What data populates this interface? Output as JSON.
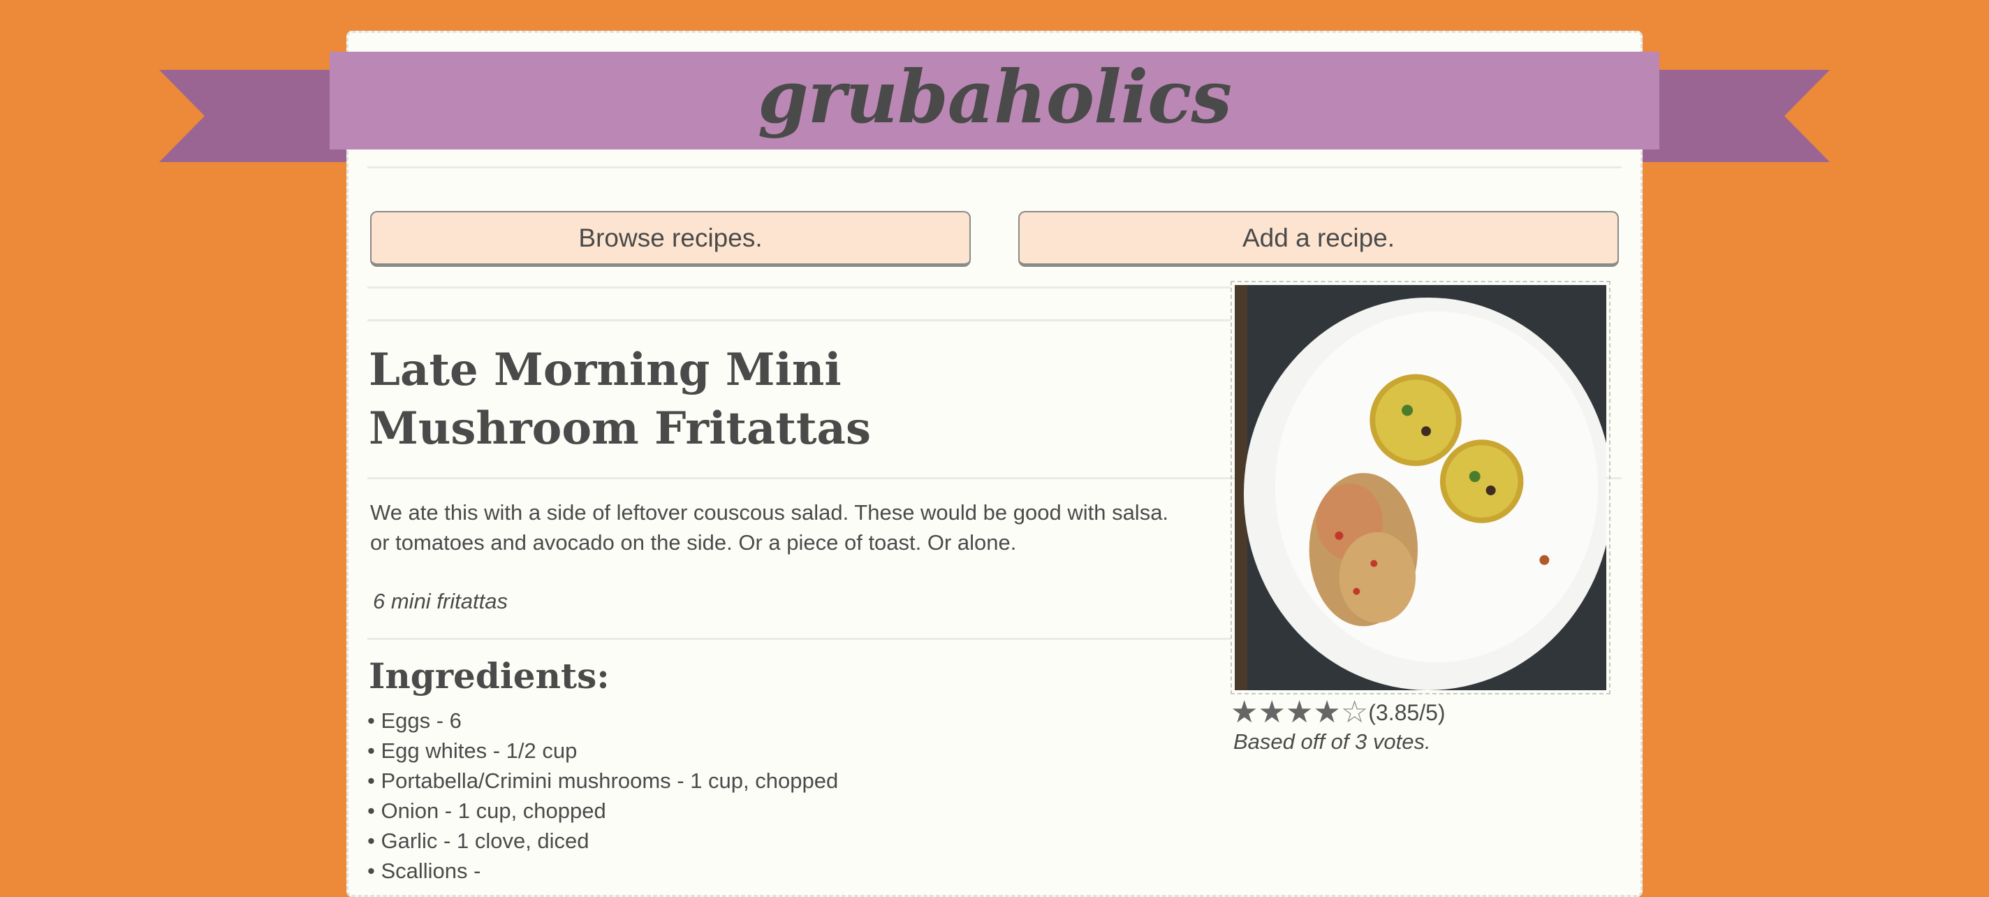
{
  "site": {
    "logo": "grubaholics"
  },
  "nav": {
    "browse_label": "Browse recipes.",
    "add_label": "Add a recipe."
  },
  "recipe": {
    "title": "Late Morning Mini Mushroom Fritattas",
    "description": "We ate this with a side of leftover couscous salad. These would be good with salsa. or tomatoes and avocado on the side. Or a piece of toast. Or alone.",
    "yield": "6 mini fritattas",
    "ingredients_heading": "Ingredients:",
    "ingredients": [
      "Eggs - 6",
      "Egg whites - 1/2 cup",
      "Portabella/Crimini mushrooms - 1 cup, chopped",
      "Onion - 1 cup, chopped",
      "Garlic - 1 clove, diced",
      "Scallions -"
    ],
    "rating": {
      "value": 3.85,
      "max": 5,
      "text": "(3.85/5)",
      "votes_text": "Based off of 3 votes."
    }
  },
  "colors": {
    "background": "#EC8A39",
    "banner": "#BB87B5",
    "ribbon_tail": "#9A6592",
    "button": "#FDE4D0",
    "text": "#4a4a4a"
  },
  "icons": {
    "star_filled": "star-filled-icon",
    "star_empty": "star-empty-icon"
  }
}
